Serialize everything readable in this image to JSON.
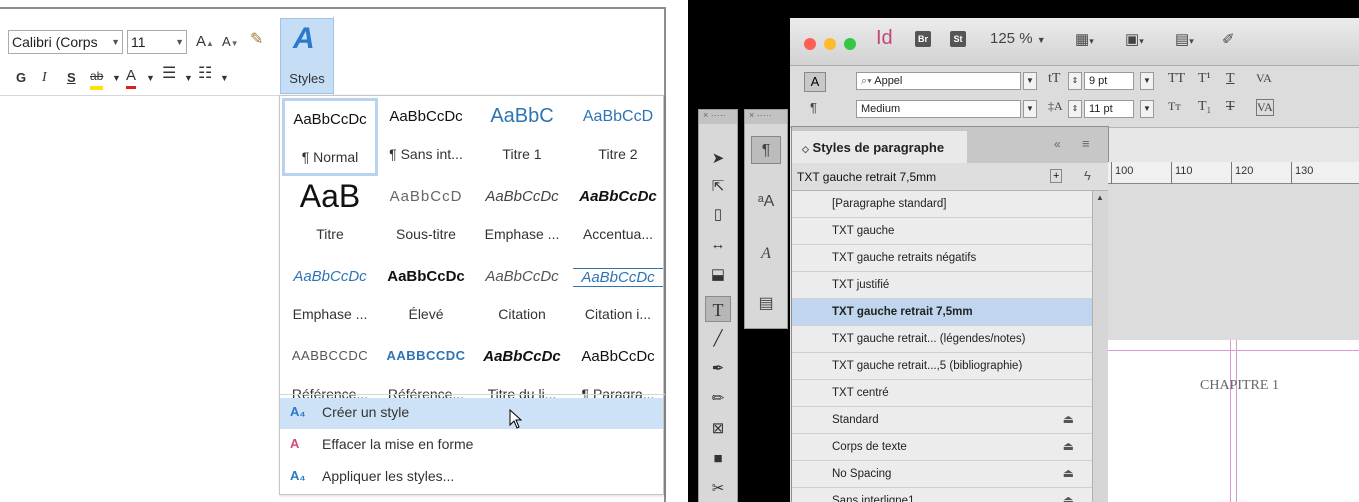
{
  "word": {
    "font_name": "Calibri (Corps",
    "font_size": "11",
    "grow_font": "A",
    "shrink_font": "A",
    "bold": "G",
    "italic": "I",
    "underline": "S",
    "strike": "ab",
    "font_color": "A",
    "styles_label": "Styles",
    "gallery": [
      {
        "sample": "AaBbCcDc",
        "name": "¶ Normal"
      },
      {
        "sample": "AaBbCcDc",
        "name": "¶ Sans int..."
      },
      {
        "sample": "AaBbC",
        "name": "Titre 1"
      },
      {
        "sample": "AaBbCcD",
        "name": "Titre 2"
      },
      {
        "sample": "AaB",
        "name": "Titre"
      },
      {
        "sample": "AaBbCcD",
        "name": "Sous-titre"
      },
      {
        "sample": "AaBbCcDc",
        "name": "Emphase ..."
      },
      {
        "sample": "AaBbCcDc",
        "name": "Accentua..."
      },
      {
        "sample": "AaBbCcDc",
        "name": "Emphase ..."
      },
      {
        "sample": "AaBbCcDc",
        "name": "Élevé"
      },
      {
        "sample": "AaBbCcDc",
        "name": "Citation"
      },
      {
        "sample": "AaBbCcDc",
        "name": "Citation i..."
      },
      {
        "sample": "AABBCCDC",
        "name": "Référence..."
      },
      {
        "sample": "AABBCCDC",
        "name": "Référence..."
      },
      {
        "sample": "AaBbCcDc",
        "name": "Titre du li..."
      },
      {
        "sample": "AaBbCcDc",
        "name": "¶ Paragra..."
      }
    ],
    "menu": [
      {
        "icon": "create-style-icon",
        "label": "Créer un style"
      },
      {
        "icon": "clear-formatting-icon",
        "label": "Effacer la mise en forme"
      },
      {
        "icon": "apply-styles-icon",
        "label": "Appliquer les styles..."
      }
    ]
  },
  "indesign": {
    "app_badge": "Id",
    "br": "Br",
    "st": "St",
    "zoom": "125 %",
    "font_field": "Appel",
    "font_style": "Medium",
    "size_field": "9 pt",
    "leading_field": "11 pt",
    "panel_title": "Styles de paragraphe",
    "current_style": "TXT gauche retrait 7,5mm",
    "styles": [
      {
        "name": "[Paragraphe standard]",
        "locked": false,
        "selected": false
      },
      {
        "name": "TXT gauche",
        "locked": false,
        "selected": false
      },
      {
        "name": "TXT gauche retraits négatifs",
        "locked": false,
        "selected": false
      },
      {
        "name": "TXT justifié",
        "locked": false,
        "selected": false
      },
      {
        "name": "TXT gauche retrait 7,5mm",
        "locked": false,
        "selected": true
      },
      {
        "name": "TXT gauche retrait... (légendes/notes)",
        "locked": false,
        "selected": false
      },
      {
        "name": "TXT gauche retrait...,5 (bibliographie)",
        "locked": false,
        "selected": false
      },
      {
        "name": "TXT centré",
        "locked": false,
        "selected": false
      },
      {
        "name": "Standard",
        "locked": true,
        "selected": false
      },
      {
        "name": "Corps de texte",
        "locked": true,
        "selected": false
      },
      {
        "name": "No Spacing",
        "locked": true,
        "selected": false
      },
      {
        "name": "Sans interligne1",
        "locked": true,
        "selected": false
      }
    ],
    "ruler": [
      "100",
      "110",
      "120",
      "130"
    ],
    "page_text": "CHAPITRE 1"
  },
  "colors": {
    "word_accent": "#2b79c9",
    "word_selection": "#cde2f6",
    "id_selection": "#bfd6ee"
  }
}
